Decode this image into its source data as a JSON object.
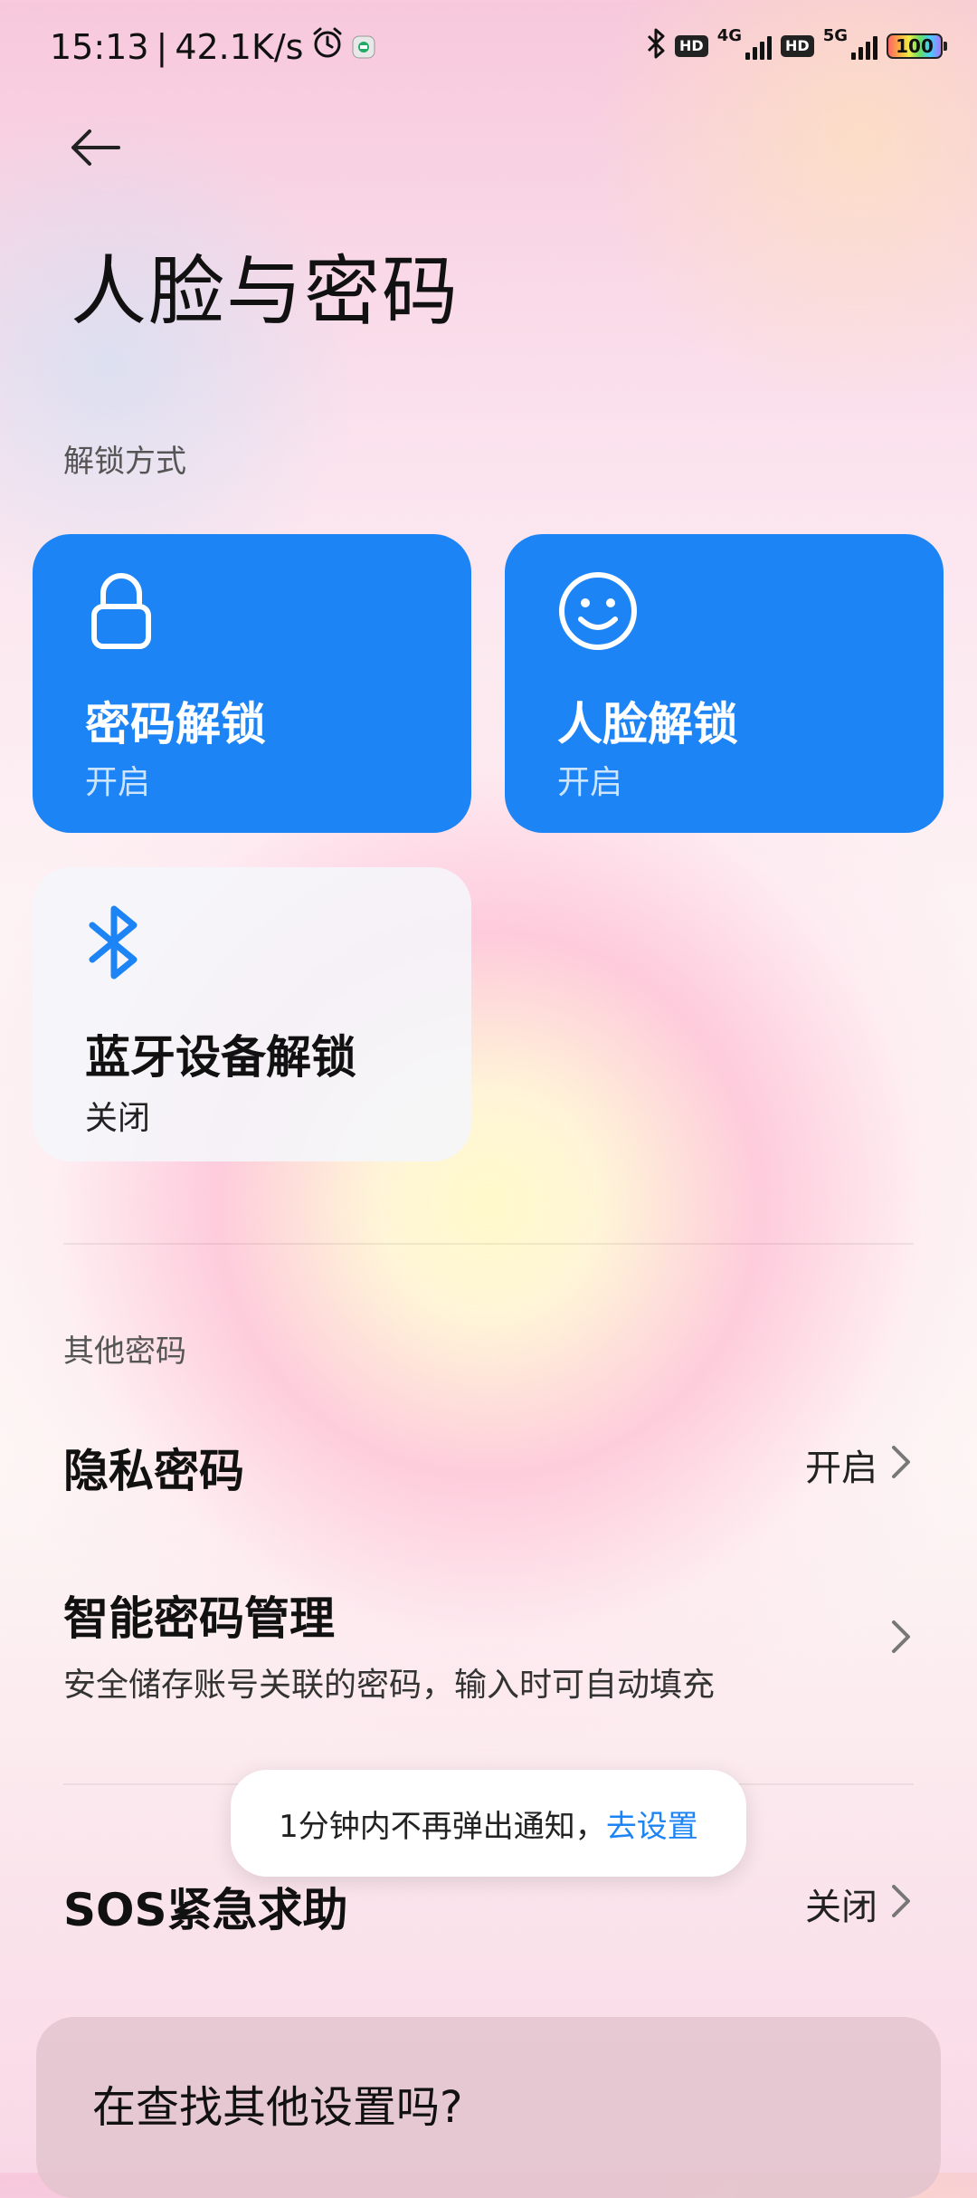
{
  "status_bar": {
    "time": "15:13",
    "separator": "|",
    "net_speed": "42.1K/s",
    "hd1": "HD",
    "net1": "4G",
    "hd2": "HD",
    "net2": "5G",
    "battery": "100",
    "icons": [
      "alarm-icon",
      "app-notification-icon",
      "bluetooth-icon",
      "signal-icon",
      "battery-icon"
    ]
  },
  "header": {
    "title": "人脸与密码"
  },
  "unlock_section": {
    "label": "解锁方式",
    "cards": [
      {
        "title": "密码解锁",
        "state": "开启",
        "icon": "lock-icon"
      },
      {
        "title": "人脸解锁",
        "state": "开启",
        "icon": "face-icon"
      },
      {
        "title": "蓝牙设备解锁",
        "state": "关闭",
        "icon": "bluetooth-icon"
      }
    ]
  },
  "other_section": {
    "label": "其他密码",
    "privacy": {
      "title": "隐私密码",
      "value": "开启"
    },
    "smart": {
      "title": "智能密码管理",
      "subtitle": "安全储存账号关联的密码，输入时可自动填充"
    },
    "sos": {
      "title": "SOS紧急求助",
      "value": "关闭"
    }
  },
  "toast": {
    "text": "1分钟内不再弹出通知，",
    "link": "去设置"
  },
  "find_card": {
    "text": "在查找其他设置吗?"
  },
  "colors": {
    "accent": "#1d84f6",
    "card_light": "#f5f6fa"
  }
}
